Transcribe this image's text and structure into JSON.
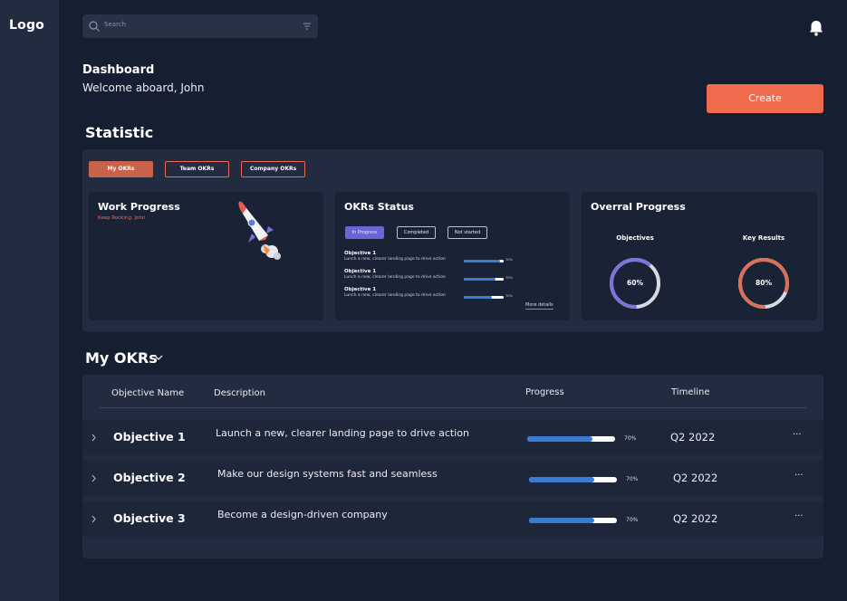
{
  "sidebar": {
    "logo": "Logo"
  },
  "search": {
    "placeholder": "Search"
  },
  "header": {
    "title": "Dashboard",
    "welcome": "Welcome aboard, John",
    "create_label": "Create"
  },
  "statistic": {
    "title": "Statistic",
    "tabs": [
      {
        "label": "My OKRs",
        "active": true
      },
      {
        "label": "Team OKRs",
        "active": false
      },
      {
        "label": "Company OKRs",
        "active": false
      }
    ],
    "work_progress": {
      "title": "Work Progress",
      "subtitle": "Keep Rocking, John"
    },
    "okrs_status": {
      "title": "OKRs Status",
      "filters": [
        "In Progress",
        "Completed",
        "Not started"
      ],
      "items": [
        {
          "name": "Objective 1",
          "desc": "Lunch a new, clearer landing page to drive action",
          "progress": 0.9,
          "pct": "70%"
        },
        {
          "name": "Objective 1",
          "desc": "Lunch a new, clearer landing page to drive action",
          "progress": 0.8,
          "pct": "70%"
        },
        {
          "name": "Objective 1",
          "desc": "Lunch a new, clearer landing page to drive action",
          "progress": 0.7,
          "pct": "70%"
        }
      ],
      "more": "More details"
    },
    "overall": {
      "title": "Overral Progress",
      "objectives": {
        "label": "Objectives",
        "value": 60,
        "pct": "60%",
        "color": "#7d73d8"
      },
      "key_results": {
        "label": "Key Results",
        "value": 80,
        "pct": "80%",
        "color": "#d9705a"
      }
    }
  },
  "my_okrs": {
    "title": "My OKRs",
    "headers": [
      "Objective Name",
      "Description",
      "Progress",
      "Timeline"
    ],
    "rows": [
      {
        "name": "Objective 1",
        "desc": "Launch a new, clearer landing page to drive action",
        "progress": 0.74,
        "pct": "70%",
        "timeline": "Q2 2022"
      },
      {
        "name": "Objective 2",
        "desc": "Make our design systems fast and seamless",
        "progress": 0.74,
        "pct": "70%",
        "timeline": "Q2 2022"
      },
      {
        "name": "Objective 3",
        "desc": "Become a design-driven company",
        "progress": 0.74,
        "pct": "70%",
        "timeline": "Q2 2022"
      }
    ],
    "menu_glyph": "···"
  },
  "colors": {
    "accent": "#ee6c4d",
    "progress": "#3a7bd5",
    "background": "#161e32",
    "panel": "#222b40"
  }
}
